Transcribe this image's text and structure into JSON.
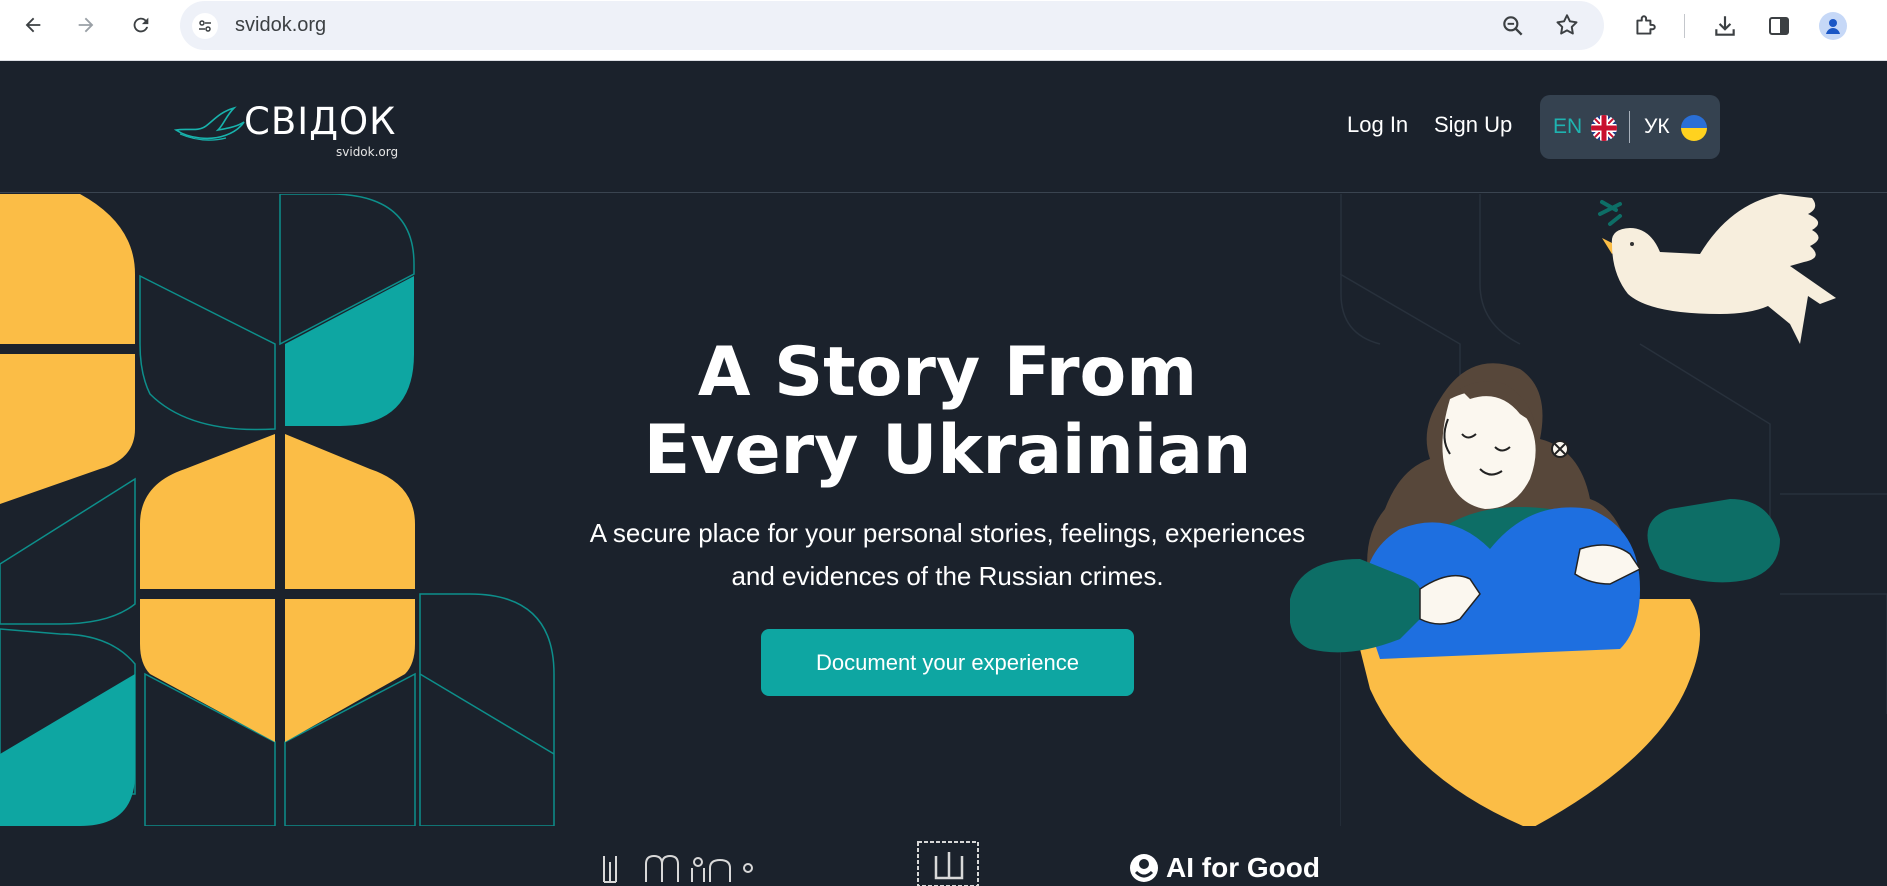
{
  "browser": {
    "url": "svidok.org",
    "icons": [
      "back-icon",
      "forward-icon",
      "reload-icon",
      "site-info-icon",
      "zoom-icon",
      "bookmark-star-icon",
      "extensions-icon",
      "downloads-icon",
      "side-panel-icon",
      "profile-icon"
    ]
  },
  "header": {
    "logo_text": "СВІДОК",
    "logo_subdomain": "svidok.org",
    "login_label": "Log In",
    "signup_label": "Sign Up",
    "lang_en": "EN",
    "lang_uk": "УК"
  },
  "hero": {
    "title_line1": "A Story From",
    "title_line2": "Every Ukrainian",
    "subtitle_line1": "A secure place for your personal stories, feelings, experiences",
    "subtitle_line2": "and evidences of the Russian crimes.",
    "cta_label": "Document your experience"
  },
  "partners": {
    "ai_for_good": "AI for Good"
  },
  "colors": {
    "background": "#1b222c",
    "accent_teal": "#0ea6a2",
    "yellow": "#fbbd46",
    "blue": "#1e6fe0",
    "dark_teal": "#0d6e66"
  }
}
